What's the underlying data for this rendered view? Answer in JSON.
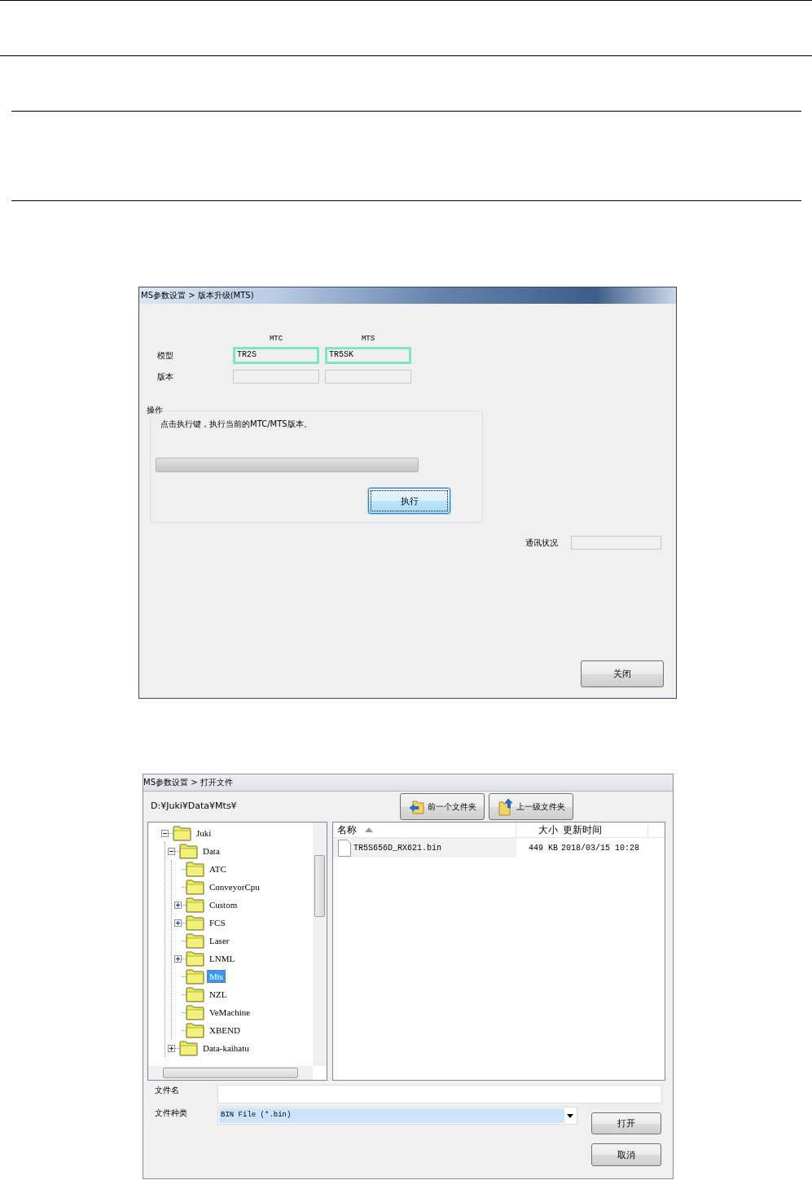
{
  "update_window": {
    "title": "MS参数设置 > 版本升级(MTS)",
    "columns": [
      "MTC",
      "MTS"
    ],
    "rows": [
      {
        "label": "模型",
        "fields": [
          {
            "value": "TR2S",
            "highlighted": true
          },
          {
            "value": "TR5SK",
            "highlighted": true
          }
        ]
      },
      {
        "label": "版本",
        "fields": [
          {
            "highlighted": false
          },
          {
            "highlighted": false
          }
        ]
      }
    ],
    "operation": {
      "legend": "操作",
      "message": "点击执行键，执行当前的MTC/MTS版本。",
      "progress": {
        "level": 0
      },
      "button": {
        "label": "执行",
        "focused": true
      }
    },
    "status": {
      "label": "通讯状况"
    },
    "close_button": {
      "label": "关闭",
      "focused": false
    }
  },
  "open_window": {
    "title": "MS参数设置 > 打开文件",
    "path": "D:¥Juki¥Data¥Mts¥",
    "nav_buttons": [
      {
        "label": "前一个文件夹",
        "kind": "back"
      },
      {
        "label": "上一级文件夹",
        "kind": "up"
      }
    ],
    "tree": [
      {
        "label": "Juki",
        "expanded": true,
        "selected": false,
        "children": [
          {
            "label": "Data",
            "expanded": true,
            "selected": false,
            "children": [
              {
                "label": "ATC",
                "selected": false
              },
              {
                "label": "ConveyorCpu",
                "selected": false
              },
              {
                "label": "Custom",
                "expanded": false,
                "selected": false
              },
              {
                "label": "FCS",
                "expanded": false,
                "selected": false
              },
              {
                "label": "Laser",
                "selected": false
              },
              {
                "label": "LNML",
                "expanded": false,
                "selected": false
              },
              {
                "label": "Mts",
                "selected": true
              },
              {
                "label": "NZL",
                "selected": false
              },
              {
                "label": "VeMachine",
                "selected": false
              },
              {
                "label": "XBEND",
                "selected": false
              }
            ]
          },
          {
            "label": "Data-kaihatu",
            "expanded": false,
            "selected": false
          }
        ]
      }
    ],
    "list": {
      "columns": [
        {
          "label": "名称",
          "sorted": true
        },
        {
          "label": "大小",
          "sorted": false
        },
        {
          "label": "更新时间",
          "sorted": false
        }
      ],
      "rows": [
        {
          "name": "TR5S656D_RX621.bin",
          "size": "449 KB",
          "modified": "2018/03/15 10:28",
          "selected": true
        }
      ]
    },
    "file_name": {
      "label": "文件名"
    },
    "file_type": {
      "label": "文件种类",
      "value": "BIN File (*.bin)"
    },
    "buttons": [
      {
        "label": "打开",
        "focused": false
      },
      {
        "label": "取消",
        "focused": false
      }
    ]
  }
}
